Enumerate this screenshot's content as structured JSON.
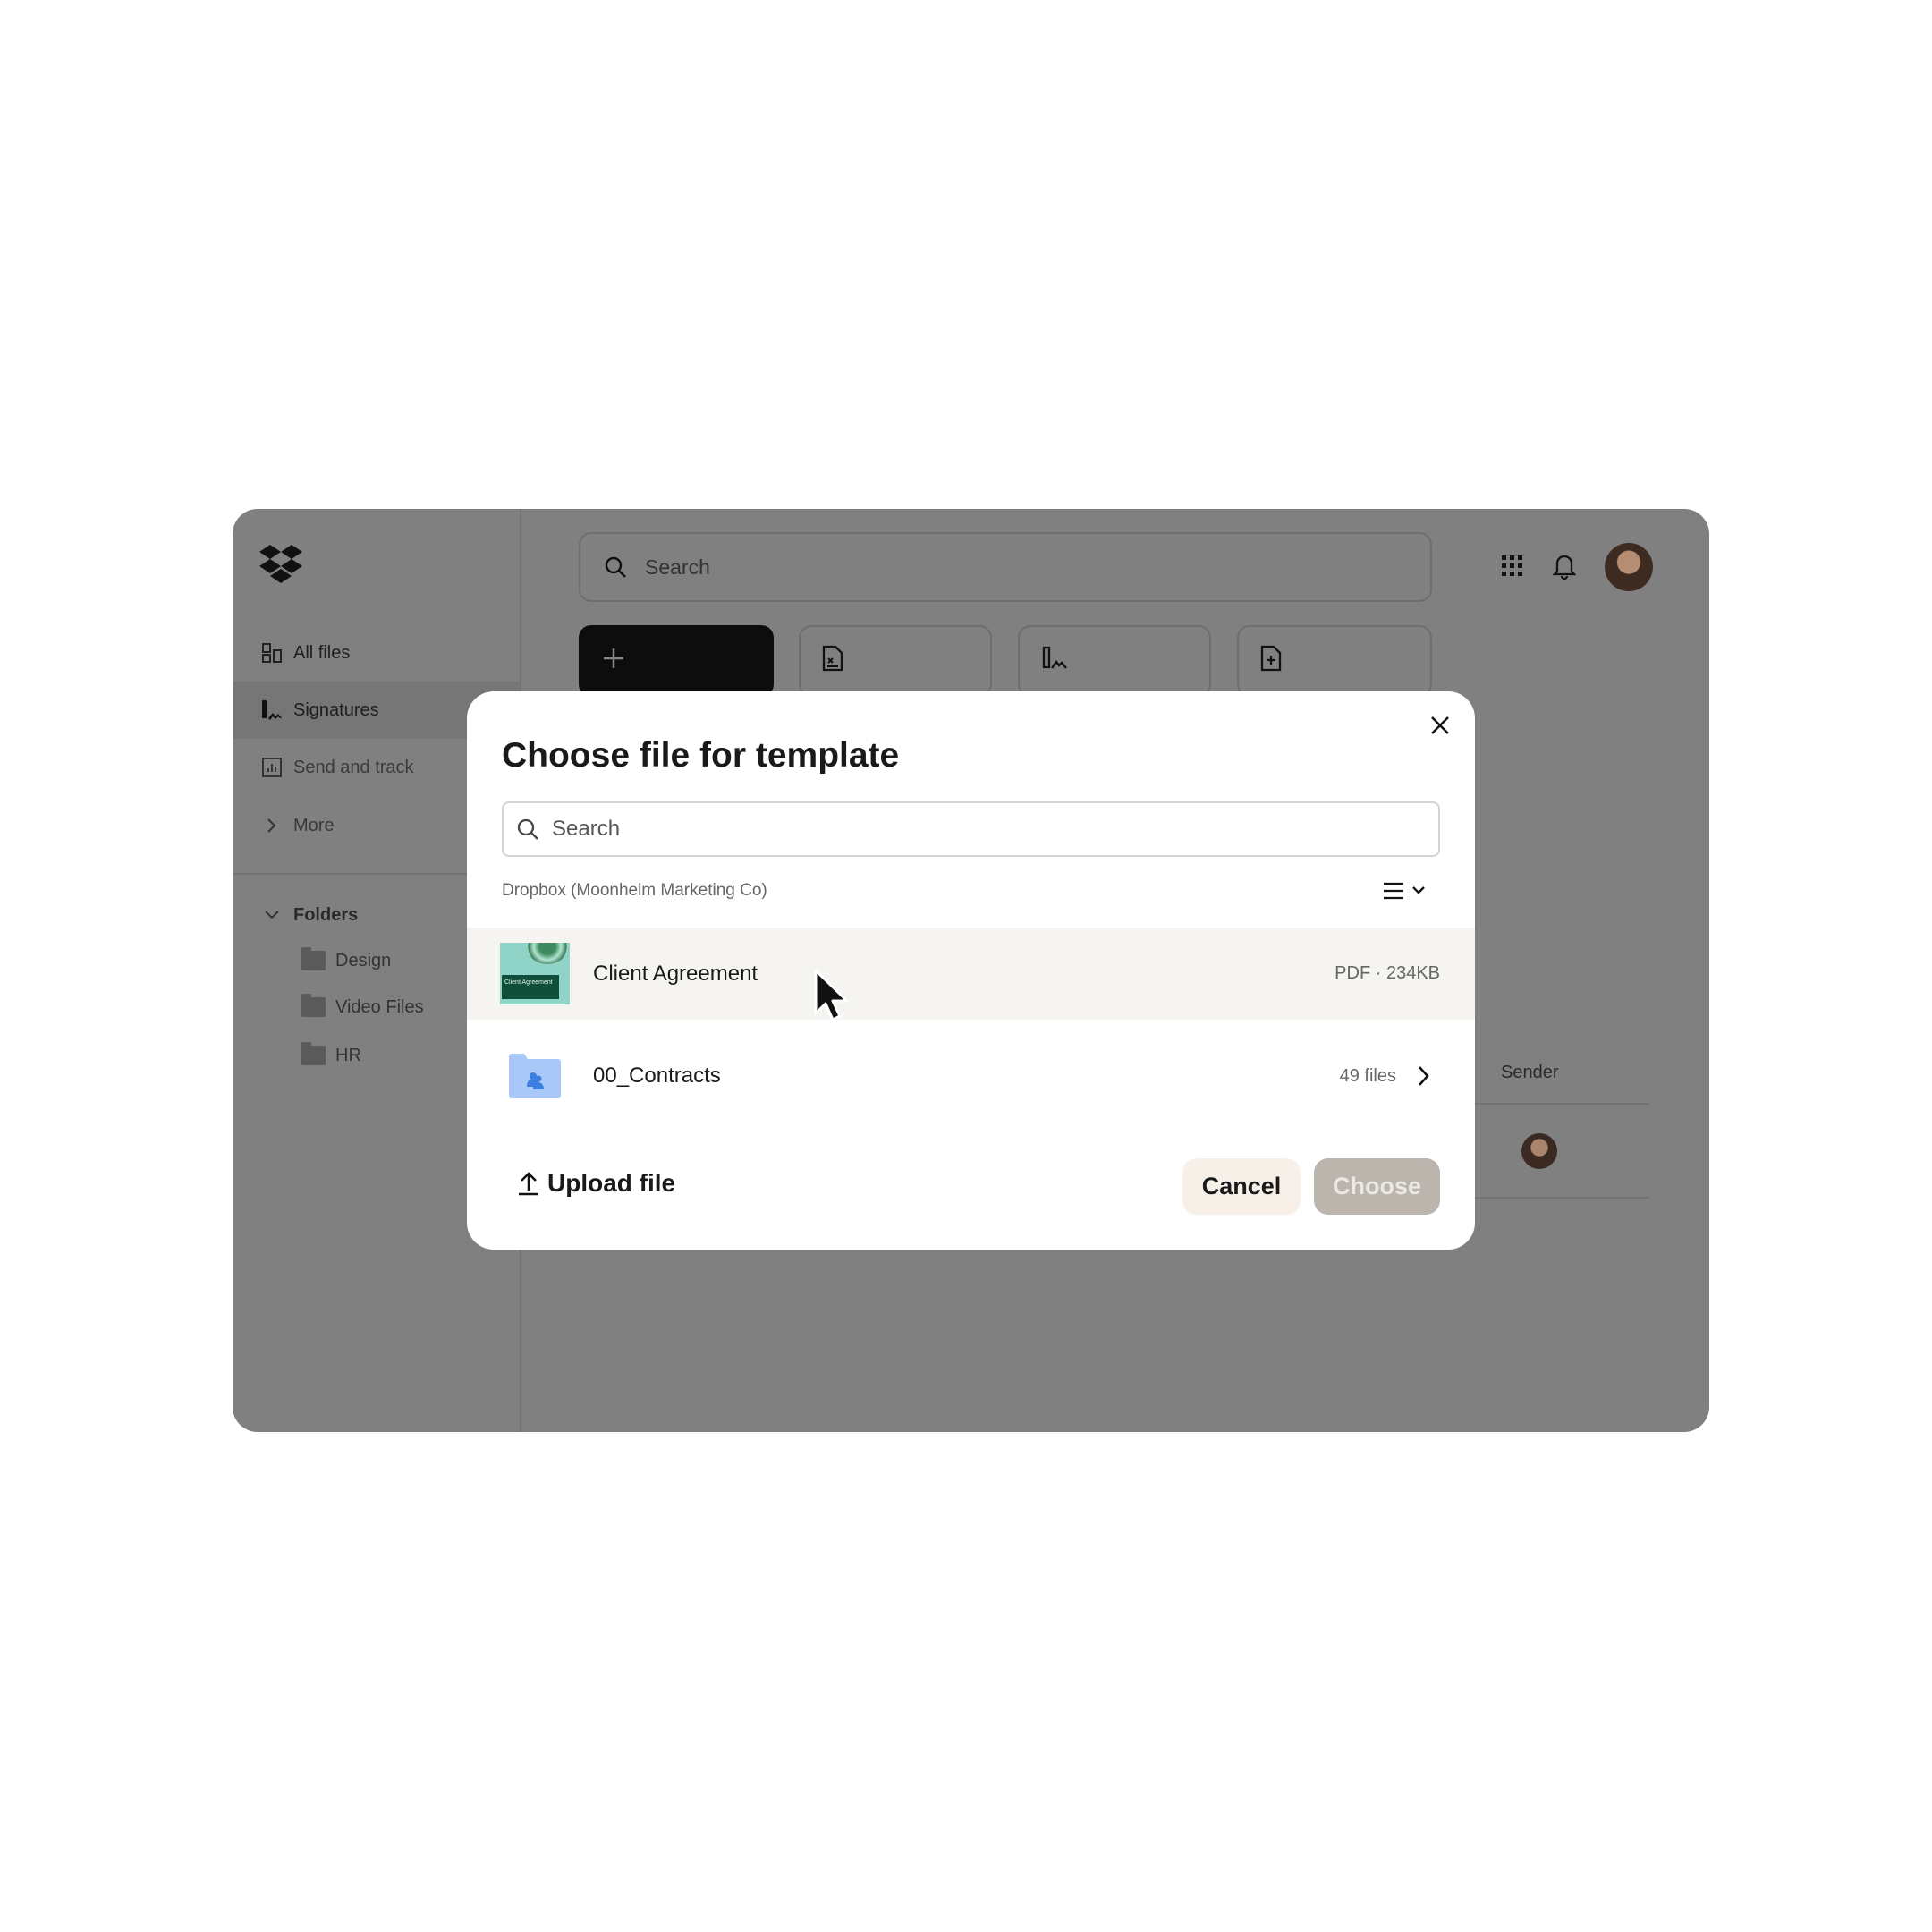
{
  "topbar": {
    "search_placeholder": "Search"
  },
  "sidebar": {
    "items": [
      {
        "label": "All files",
        "icon": "all-files-icon"
      },
      {
        "label": "Signatures",
        "icon": "signature-icon",
        "selected": true
      },
      {
        "label": "Send and track",
        "icon": "chart-icon"
      },
      {
        "label": "More",
        "icon": "chevron-right-icon"
      }
    ],
    "folders_label": "Folders",
    "folders": [
      "Design",
      "Video Files",
      "HR"
    ]
  },
  "background_table": {
    "sender_header": "Sender"
  },
  "modal": {
    "title": "Choose file for template",
    "search_placeholder": "Search",
    "breadcrumb": "Dropbox (Moonhelm Marketing Co)",
    "thumbnail_text": "Client Agreement",
    "items": [
      {
        "name": "Client Agreement",
        "meta": "PDF · 234KB",
        "type": "pdf",
        "hovered": true
      },
      {
        "name": "00_Contracts",
        "meta": "49 files",
        "type": "shared-folder"
      }
    ],
    "upload_label": "Upload file",
    "cancel_label": "Cancel",
    "choose_label": "Choose"
  },
  "colors": {
    "overlay": "#808080",
    "hover_row": "#f5f4f1",
    "cancel_bg": "#f6f0e8",
    "choose_disabled_bg": "#bbb5ae",
    "folder_blue": "#a7c8f8"
  }
}
